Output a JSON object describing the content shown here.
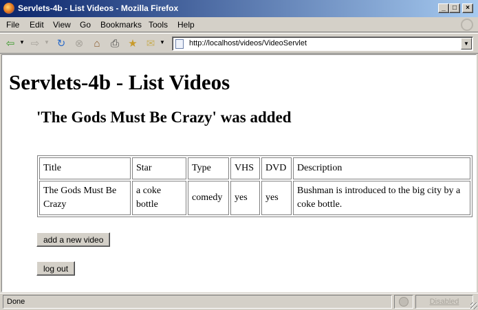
{
  "window": {
    "title": "Servlets-4b - List Videos - Mozilla Firefox"
  },
  "menu": [
    {
      "label": "File"
    },
    {
      "label": "Edit"
    },
    {
      "label": "View"
    },
    {
      "label": "Go"
    },
    {
      "label": "Bookmarks"
    },
    {
      "label": "Tools"
    },
    {
      "label": "Help"
    }
  ],
  "address": {
    "url": "http://localhost/videos/VideoServlet"
  },
  "page": {
    "heading": "Servlets-4b - List Videos",
    "message": "'The Gods Must Be Crazy' was added",
    "table": {
      "headers": [
        "Title",
        "Star",
        "Type",
        "VHS",
        "DVD",
        "Description"
      ],
      "rows": [
        [
          "The Gods Must Be Crazy",
          "a coke bottle",
          "comedy",
          "yes",
          "yes",
          "Bushman is introduced to the big city by a coke bottle."
        ]
      ]
    },
    "add_button": "add a new video",
    "logout_button": "log out"
  },
  "status": {
    "text": "Done",
    "popup_state": "Disabled"
  },
  "colors": {
    "titlebar_start": "#0a246a",
    "titlebar_end": "#a6caf0",
    "chrome": "#d4d0c8"
  },
  "icons": [
    "firefox-icon",
    "back-icon",
    "forward-icon",
    "reload-icon",
    "stop-icon",
    "home-icon",
    "print-icon",
    "bookmark-icon",
    "mail-icon",
    "page-icon"
  ]
}
